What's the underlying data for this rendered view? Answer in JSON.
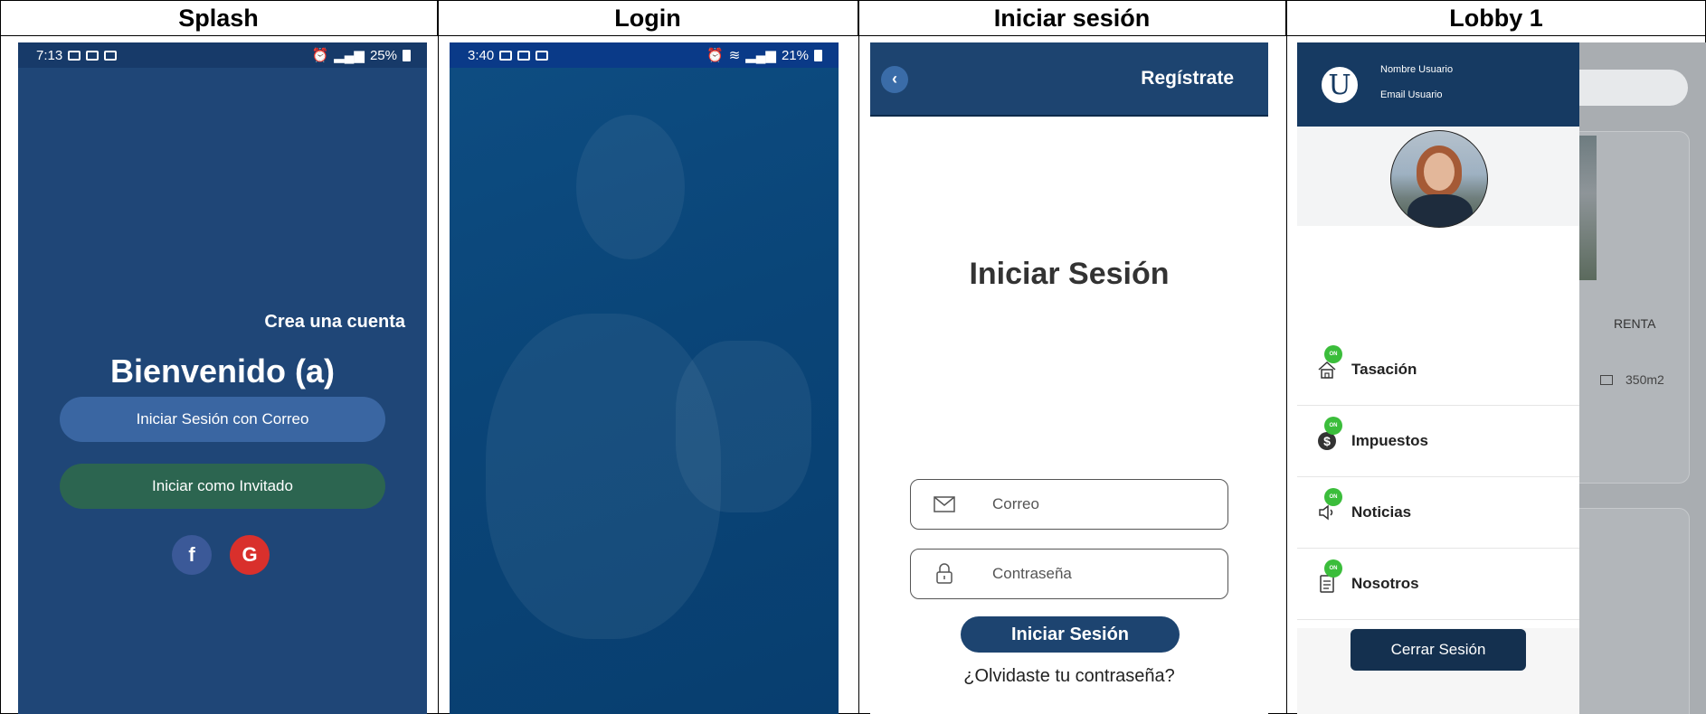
{
  "headers": [
    "Splash",
    "Login",
    "Iniciar sesión",
    "Lobby 1"
  ],
  "splash": {
    "status_time": "7:13",
    "status_battery": "25%",
    "create_account": "Crea una cuenta",
    "welcome": "Bienvenido (a)",
    "email_login_button": "Iniciar Sesión con Correo",
    "guest_button": "Iniciar como Invitado",
    "social_facebook": "f",
    "social_google": "G"
  },
  "login": {
    "status_time": "3:40",
    "status_battery": "21%"
  },
  "signin": {
    "back_icon": "‹",
    "register_link": "Regístrate",
    "title": "Iniciar Sesión",
    "email_placeholder": "Correo",
    "password_placeholder": "Contraseña",
    "submit_button": "Iniciar Sesión",
    "forgot_link": "¿Olvidaste tu contraseña?"
  },
  "lobby": {
    "avatar_letter": "U",
    "user_name": "Nombre Usuario",
    "user_email": "Email Usuario",
    "menu": [
      {
        "label": "Tasación",
        "badge": "ON"
      },
      {
        "label": "Impuestos",
        "badge": "ON"
      },
      {
        "label": "Noticias",
        "badge": "ON"
      },
      {
        "label": "Nosotros",
        "badge": "ON"
      }
    ],
    "logout_button": "Cerrar Sesión",
    "bg_renta": "RENTA",
    "bg_area": "350m2"
  },
  "colors": {
    "splash_bg": "#1f4677",
    "navy": "#1d4470",
    "badge_green": "#3bbd3b",
    "guest_green": "#2c6550"
  }
}
